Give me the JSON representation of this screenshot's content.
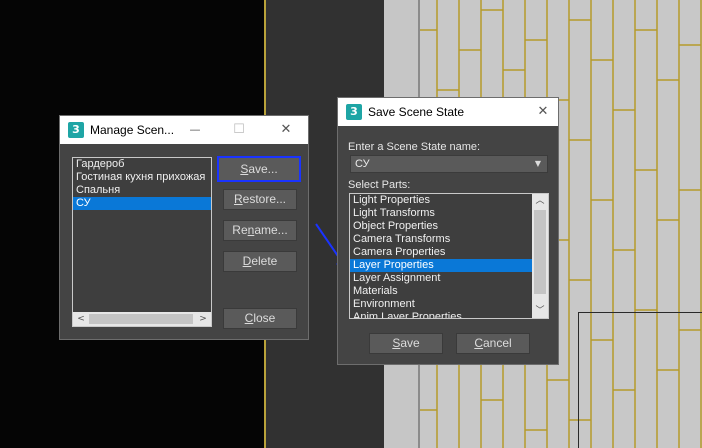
{
  "manage_dialog": {
    "title": "Manage Scen...",
    "icon_glyph": "3",
    "minimize_glyph": "—",
    "maximize_glyph": "☐",
    "close_glyph": "✕",
    "items": [
      "Гардероб",
      "Гостиная кухня прихожая",
      "Спальня",
      "СУ"
    ],
    "selected_index": 3,
    "buttons": {
      "save": {
        "ul": "S",
        "rest": "ave..."
      },
      "restore": {
        "ul": "R",
        "rest": "estore..."
      },
      "rename": {
        "pre": "Re",
        "ul": "n",
        "rest": "ame..."
      },
      "delete": {
        "ul": "D",
        "rest": "elete"
      },
      "close": {
        "ul": "C",
        "rest": "lose"
      }
    },
    "scroll_left_glyph": "<",
    "scroll_right_glyph": ">"
  },
  "save_dialog": {
    "title": "Save Scene State",
    "icon_glyph": "3",
    "close_glyph": "✕",
    "name_label": "Enter a Scene State name:",
    "name_value": "СУ",
    "combo_arrow_glyph": "▼",
    "parts_label": "Select Parts:",
    "parts": [
      "Light Properties",
      "Light Transforms",
      "Object Properties",
      "Camera Transforms",
      "Camera Properties",
      "Layer Properties",
      "Layer Assignment",
      "Materials",
      "Environment",
      "Anim Layer Properties"
    ],
    "selected_index": 5,
    "scroll_up_glyph": "︿",
    "scroll_down_glyph": "﹀",
    "buttons": {
      "save": {
        "ul": "S",
        "rest": "ave"
      },
      "cancel": {
        "ul": "C",
        "rest": "ancel"
      }
    }
  },
  "colors": {
    "accent_focus": "#1a33ff",
    "selection": "#0a78d7",
    "app_icon": "#1ea5a5",
    "annotation_arrow": "#1a33ff"
  }
}
